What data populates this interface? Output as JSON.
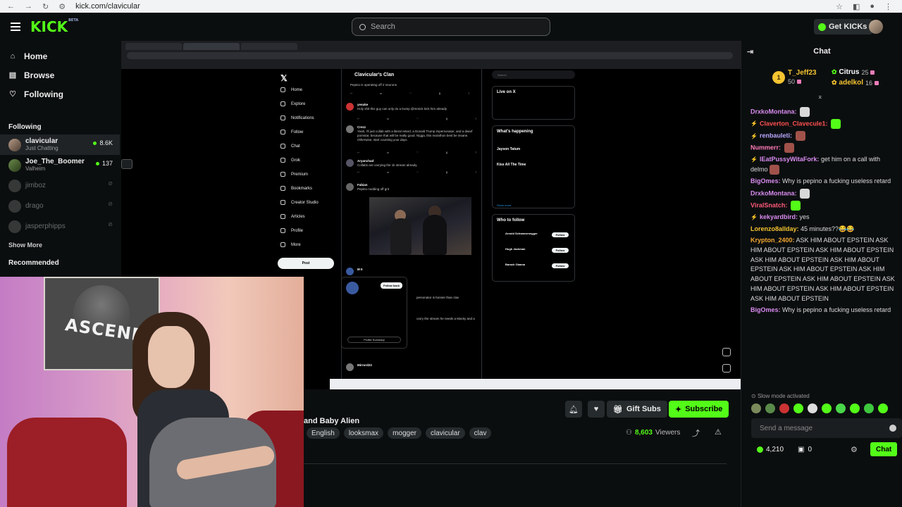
{
  "browser": {
    "url": "kick.com/clavicular"
  },
  "header": {
    "logo": "KICK",
    "logo_badge": "BETA",
    "search_placeholder": "Search",
    "get_kicks": "Get KICKs"
  },
  "sidebar": {
    "nav": [
      {
        "label": "Home",
        "icon": "home-icon"
      },
      {
        "label": "Browse",
        "icon": "browse-icon"
      },
      {
        "label": "Following",
        "icon": "heart-icon"
      }
    ],
    "following_title": "Following",
    "following": [
      {
        "name": "clavicular",
        "game": "Just Chatting",
        "viewers": "8.6K",
        "live": true
      },
      {
        "name": "Joe_The_Boomer",
        "game": "Valheim",
        "viewers": "137",
        "live": true
      },
      {
        "name": "jimboz",
        "live": false
      },
      {
        "name": "drago",
        "live": false
      },
      {
        "name": "jasperphipps",
        "live": false
      }
    ],
    "show_more": "Show More",
    "recommended_title": "Recommended"
  },
  "stream": {
    "title_fragment": "and Baby Alien",
    "tags": [
      "English",
      "looksmax",
      "mogger",
      "clavicular",
      "clav"
    ],
    "gift_subs": "Gift Subs",
    "subscribe": "Subscribe",
    "viewers_count": "8,603",
    "viewers_label": "Viewers"
  },
  "embedded": {
    "community_title": "Clavicular's Clan",
    "x_nav": [
      "Home",
      "Explore",
      "Notifications",
      "Follow",
      "Chat",
      "Grok",
      "Premium",
      "Bookmarks",
      "Creator Studio",
      "Articles",
      "Profile",
      "More"
    ],
    "post_button": "Post",
    "right_search": "Search",
    "live_on_x": "Live on X",
    "whats_happening": "What's happening",
    "who_to_follow": "Who to follow",
    "follow_btn": "Follow",
    "follow_back": "Follow back",
    "profile_summary": "Profile Summary",
    "show_more": "Show more",
    "follow_names": [
      "Arnold Schwarzenegger",
      "Hugh Jackman",
      "Barack Obama"
    ],
    "trends": [
      "Jayson Tatum",
      "Kiss All The Time"
    ],
    "tweets": [
      {
        "name": "Pepino is operating off 2 neurons"
      },
      {
        "name": "yesuke",
        "text": "Holy shit this guy can only do a trump @mmick kick him already"
      },
      {
        "name": "Crezz",
        "text": "Yeah, i'll just collab with a literal retard, a Donald Trump impersonator, and a dwarf pornstar, because that will be really good. Nigga, this marathon best be insane. Otherwise, start counting your days."
      },
      {
        "name": "Aryanchad",
        "text": "Collabs are carrying the 1k stream already."
      },
      {
        "name": "Fabian",
        "text": "Pepino nodding off grit"
      },
      {
        "name": "M II",
        "text": "personator is funnier than clav"
      },
      {
        "name": "",
        "text": "carry the stream he needs a Macky and a"
      },
      {
        "name": "",
        "text": "Make pepino fight baby alien"
      },
      {
        "name": "Mirrord23"
      }
    ]
  },
  "chat": {
    "title": "Chat",
    "top_gifters": [
      {
        "name": "T_Jeff23",
        "count": "50",
        "color": "#f4c430"
      },
      {
        "name": "Citrus",
        "count": "25",
        "color": "#ffffff"
      },
      {
        "name": "adelkol",
        "count": "16",
        "color": "#f4c430"
      }
    ],
    "messages": [
      {
        "user": "DrxkoMontana:",
        "color": "#d98cf0",
        "text": "",
        "emote": "#d8d8d8"
      },
      {
        "user": "Claverton_Clavecule1:",
        "color": "#ff5050",
        "text": "",
        "emote": "#53fc18"
      },
      {
        "user": "renbauleti:",
        "color": "#b9a8ff",
        "text": "",
        "emote": "#a0524a"
      },
      {
        "user": "Nummerr:",
        "color": "#ff7ab8",
        "text": "",
        "emote": "#a0524a"
      },
      {
        "user": "lEatPussyWitaFork:",
        "color": "#d98cf0",
        "text": "get him on a call with delmo",
        "emote": "#a0524a"
      },
      {
        "user": "BigOmes:",
        "color": "#d98cf0",
        "text": "Why is pepino a fucking useless retard"
      },
      {
        "user": "DrxkoMontana:",
        "color": "#d98cf0",
        "text": "",
        "emote": "#d8d8d8"
      },
      {
        "user": "ViralSnatch:",
        "color": "#ff5a7a",
        "text": "",
        "emote": "#53fc18"
      },
      {
        "user": "kekyardbird:",
        "color": "#d98cf0",
        "text": "yes"
      },
      {
        "user": "Lorenzo8allday:",
        "color": "#f4c430",
        "text": "45 minutes??😂😂"
      },
      {
        "user": "Krypton_2400:",
        "color": "#f4a830",
        "text": "ASK HIM ABOUT EPSTEIN ASK HIM ABOUT EPSTEIN ASK HIM ABOUT EPSTEIN ASK HIM ABOUT EPSTEIN ASK HIM ABOUT EPSTEIN ASK HIM ABOUT EPSTEIN ASK HIM ABOUT EPSTEIN ASK HIM ABOUT EPSTEIN ASK HIM ABOUT EPSTEIN ASK HIM ABOUT EPSTEIN ASK HIM ABOUT EPSTEIN"
      },
      {
        "user": "BigOmes:",
        "color": "#d98cf0",
        "text": "Why is pepino a fucking useless retard"
      }
    ],
    "slow_mode": "Slow mode activated",
    "input_placeholder": "Send a message",
    "points": "4,210",
    "kicks": "0",
    "send_button": "Chat"
  },
  "colors": {
    "accent": "#53fc18",
    "bg": "#0b0e0f"
  }
}
